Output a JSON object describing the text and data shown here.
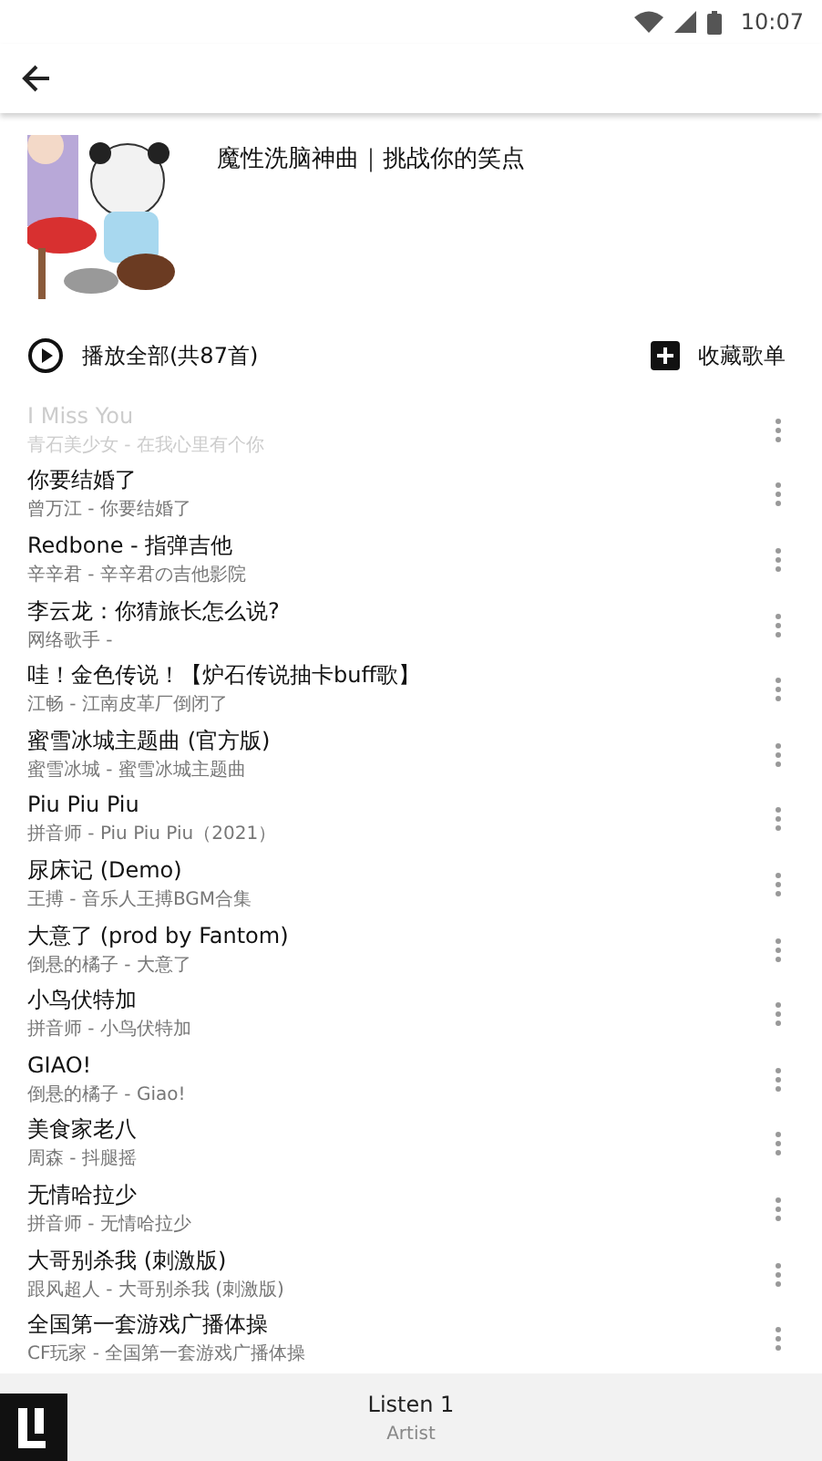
{
  "status_bar": {
    "time": "10:07"
  },
  "playlist": {
    "title": "魔性洗脑神曲｜挑战你的笑点"
  },
  "actions": {
    "play_all": "播放全部(共87首)",
    "favorite": "收藏歌单"
  },
  "songs": [
    {
      "title": "I Miss You",
      "subtitle": "青石美少女 - 在我心里有个你",
      "disabled": true
    },
    {
      "title": "你要结婚了",
      "subtitle": "曾万江 - 你要结婚了",
      "disabled": false
    },
    {
      "title": "Redbone - 指弹吉他",
      "subtitle": "辛辛君 - 辛辛君の吉他影院",
      "disabled": false
    },
    {
      "title": "李云龙：你猜旅长怎么说?",
      "subtitle": "网络歌手 -",
      "disabled": false
    },
    {
      "title": "哇！金色传说！【炉石传说抽卡buff歌】",
      "subtitle": "江畅 - 江南皮革厂倒闭了",
      "disabled": false
    },
    {
      "title": "蜜雪冰城主题曲 (官方版)",
      "subtitle": "蜜雪冰城 - 蜜雪冰城主题曲",
      "disabled": false
    },
    {
      "title": "Piu Piu Piu",
      "subtitle": "拼音师 - Piu Piu Piu（2021）",
      "disabled": false
    },
    {
      "title": "尿床记 (Demo)",
      "subtitle": "王搏 - 音乐人王搏BGM合集",
      "disabled": false
    },
    {
      "title": "大意了 (prod by Fantom)",
      "subtitle": "倒悬的橘子 - 大意了",
      "disabled": false
    },
    {
      "title": "小鸟伏特加",
      "subtitle": "拼音师 - 小鸟伏特加",
      "disabled": false
    },
    {
      "title": "GIAO!",
      "subtitle": "倒悬的橘子 - Giao!",
      "disabled": false
    },
    {
      "title": "美食家老八",
      "subtitle": "周森 - 抖腿摇",
      "disabled": false
    },
    {
      "title": "无情哈拉少",
      "subtitle": "拼音师 - 无情哈拉少",
      "disabled": false
    },
    {
      "title": "大哥别杀我 (刺激版)",
      "subtitle": "跟风超人 - 大哥别杀我 (刺激版)",
      "disabled": false
    },
    {
      "title": "全国第一套游戏广播体操",
      "subtitle": "CF玩家 - 全国第一套游戏广播体操",
      "disabled": false
    }
  ],
  "now_playing": {
    "title": "Listen 1",
    "artist": "Artist"
  }
}
